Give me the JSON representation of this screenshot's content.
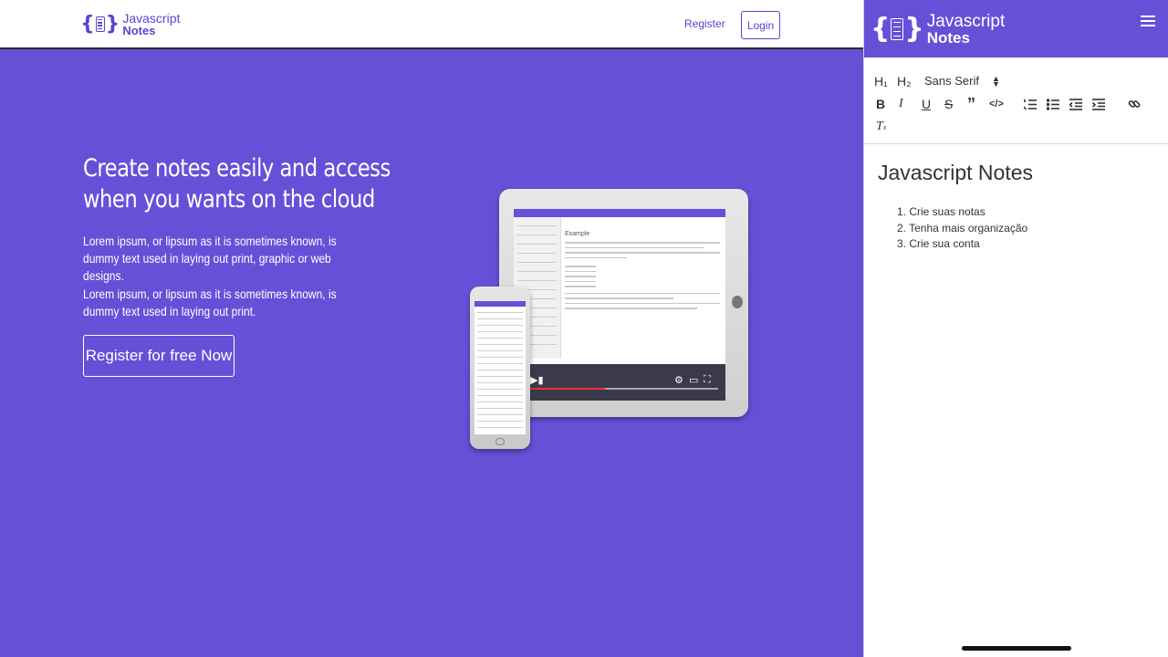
{
  "landing": {
    "logo": {
      "word1": "Javascript",
      "word2": "Notes"
    },
    "nav": {
      "register": "Register",
      "login": "Login"
    },
    "hero": {
      "title": "Create notes easily and access when you wants on the cloud",
      "paragraph1": "Lorem ipsum, or lipsum as it is sometimes known, is dummy text used in laying out print, graphic or web designs.",
      "paragraph2": "Lorem ipsum, or lipsum as it is sometimes known, is dummy text used in laying out print.",
      "cta": "Register for free Now"
    },
    "mockup": {
      "example_title": "Example",
      "video_progress": 0.4
    },
    "colors": {
      "brand": "#6750d8",
      "brand_dark": "#5b44cf"
    }
  },
  "editor": {
    "logo": {
      "word1": "Javascript",
      "word2": "Notes"
    },
    "menu_icon": "hamburger-menu-icon",
    "toolbar": {
      "h1": "H₁",
      "h2": "H₂",
      "font": "Sans Serif",
      "icons": [
        "bold-icon",
        "italic-icon",
        "underline-icon",
        "strikethrough-icon",
        "blockquote-icon",
        "code-icon",
        "ordered-list-icon",
        "bullet-list-icon",
        "outdent-icon",
        "indent-icon",
        "link-icon",
        "clear-format-icon"
      ]
    },
    "document": {
      "heading": "Javascript Notes",
      "items": [
        "Crie suas notas",
        "Tenha mais organização",
        "Crie sua conta"
      ]
    }
  }
}
